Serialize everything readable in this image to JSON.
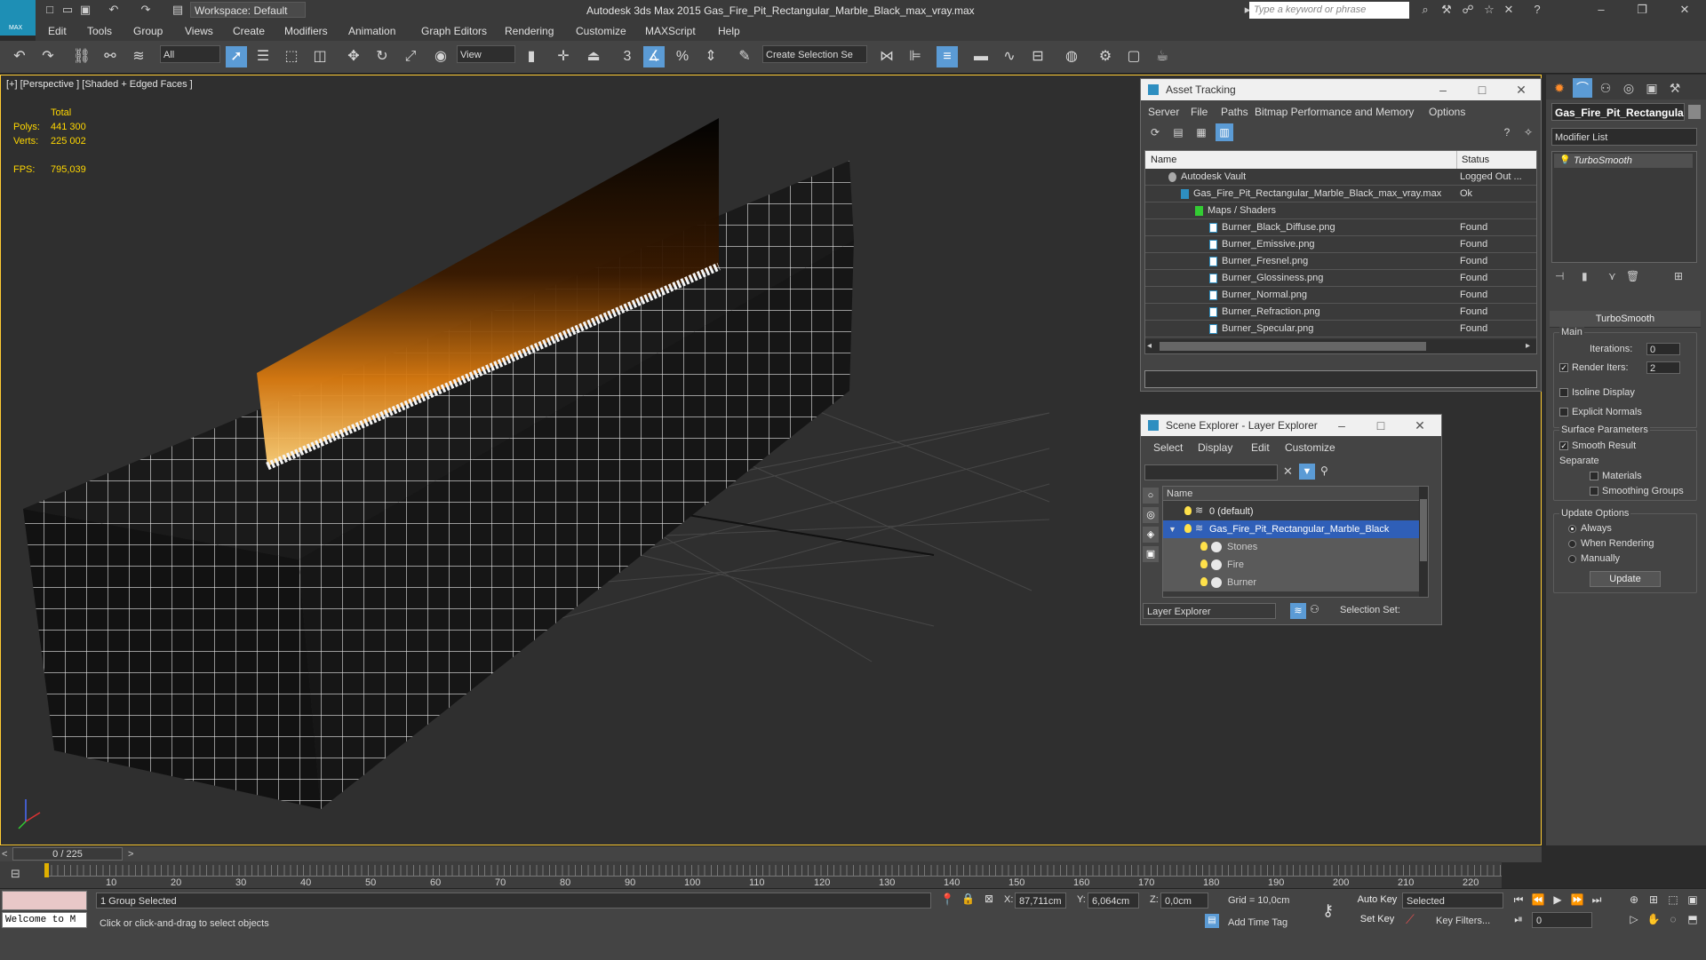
{
  "titlebar": {
    "logo": "MAX",
    "workspace": "Workspace: Default",
    "title": "Autodesk 3ds Max  2015    Gas_Fire_Pit_Rectangular_Marble_Black_max_vray.max",
    "search_placeholder": "Type a keyword or phrase"
  },
  "menu": [
    "Edit",
    "Tools",
    "Group",
    "Views",
    "Create",
    "Modifiers",
    "Animation",
    "Graph Editors",
    "Rendering",
    "Customize",
    "MAXScript",
    "Help"
  ],
  "toolbar": {
    "filter": "All",
    "refcoord": "View",
    "snap_label": "3",
    "selection_set_placeholder": "Create Selection Se"
  },
  "viewport": {
    "label": "[+] [Perspective ] [Shaded + Edged Faces ]",
    "stats": {
      "total_label": "Total",
      "polys_label": "Polys:",
      "polys_value": "441 300",
      "verts_label": "Verts:",
      "verts_value": "225 002",
      "fps_label": "FPS:",
      "fps_value": "795,039"
    }
  },
  "command_panel": {
    "object_name": "Gas_Fire_Pit_Rectangula",
    "modifier_list": "Modifier List",
    "stack_item": "TurboSmooth",
    "rollout_title": "TurboSmooth",
    "main_group": "Main",
    "iterations_label": "Iterations:",
    "iterations_value": "0",
    "render_iters_label": "Render Iters:",
    "render_iters_value": "2",
    "isoline_label": "Isoline Display",
    "explicit_normals_label": "Explicit Normals",
    "surface_group": "Surface Parameters",
    "smooth_result_label": "Smooth Result",
    "separate_label": "Separate",
    "materials_label": "Materials",
    "smoothing_groups_label": "Smoothing Groups",
    "update_group": "Update Options",
    "always_label": "Always",
    "when_rendering_label": "When Rendering",
    "manually_label": "Manually",
    "update_button": "Update"
  },
  "asset_tracking": {
    "title": "Asset Tracking",
    "menu": [
      "Server",
      "File",
      "Paths",
      "Bitmap Performance and Memory",
      "Options"
    ],
    "col_name": "Name",
    "col_status": "Status",
    "rows": [
      {
        "name": "Autodesk Vault",
        "status": "Logged Out ..."
      },
      {
        "name": "Gas_Fire_Pit_Rectangular_Marble_Black_max_vray.max",
        "status": "Ok"
      },
      {
        "name": "Maps / Shaders",
        "status": ""
      },
      {
        "name": "Burner_Black_Diffuse.png",
        "status": "Found"
      },
      {
        "name": "Burner_Emissive.png",
        "status": "Found"
      },
      {
        "name": "Burner_Fresnel.png",
        "status": "Found"
      },
      {
        "name": "Burner_Glossiness.png",
        "status": "Found"
      },
      {
        "name": "Burner_Normal.png",
        "status": "Found"
      },
      {
        "name": "Burner_Refraction.png",
        "status": "Found"
      },
      {
        "name": "Burner_Specular.png",
        "status": "Found"
      }
    ]
  },
  "scene_explorer": {
    "title": "Scene Explorer - Layer Explorer",
    "menu": [
      "Select",
      "Display",
      "Edit",
      "Customize"
    ],
    "col_name": "Name",
    "rows": [
      {
        "name": "0 (default)"
      },
      {
        "name": "Gas_Fire_Pit_Rectangular_Marble_Black"
      },
      {
        "name": "Stones"
      },
      {
        "name": "Fire"
      },
      {
        "name": "Burner"
      }
    ],
    "explorer_mode": "Layer Explorer",
    "selection_set_label": "Selection Set:"
  },
  "timeline": {
    "frame": "0 / 225",
    "ticks": [
      "10",
      "20",
      "30",
      "40",
      "50",
      "60",
      "70",
      "80",
      "90",
      "100",
      "110",
      "120",
      "130",
      "140",
      "150",
      "160",
      "170",
      "180",
      "190",
      "200",
      "210",
      "220"
    ]
  },
  "statusbar": {
    "listener": "Welcome to M",
    "selection_status": "1 Group Selected",
    "prompt": "Click or click-and-drag to select objects",
    "x_label": "X:",
    "x_value": "87,711cm",
    "y_label": "Y:",
    "y_value": "6,064cm",
    "z_label": "Z:",
    "z_value": "0,0cm",
    "grid": "Grid = 10,0cm",
    "add_time_tag": "Add Time Tag",
    "auto_key": "Auto Key",
    "set_key": "Set Key",
    "key_mode": "Selected",
    "key_filters": "Key Filters...",
    "current_frame": "0"
  },
  "colors": {
    "accent": "#5b9bd5",
    "viewport_border": "#ffcc33",
    "selection_highlight": "#2f5fb8",
    "stats_yellow": "#ffd700"
  }
}
